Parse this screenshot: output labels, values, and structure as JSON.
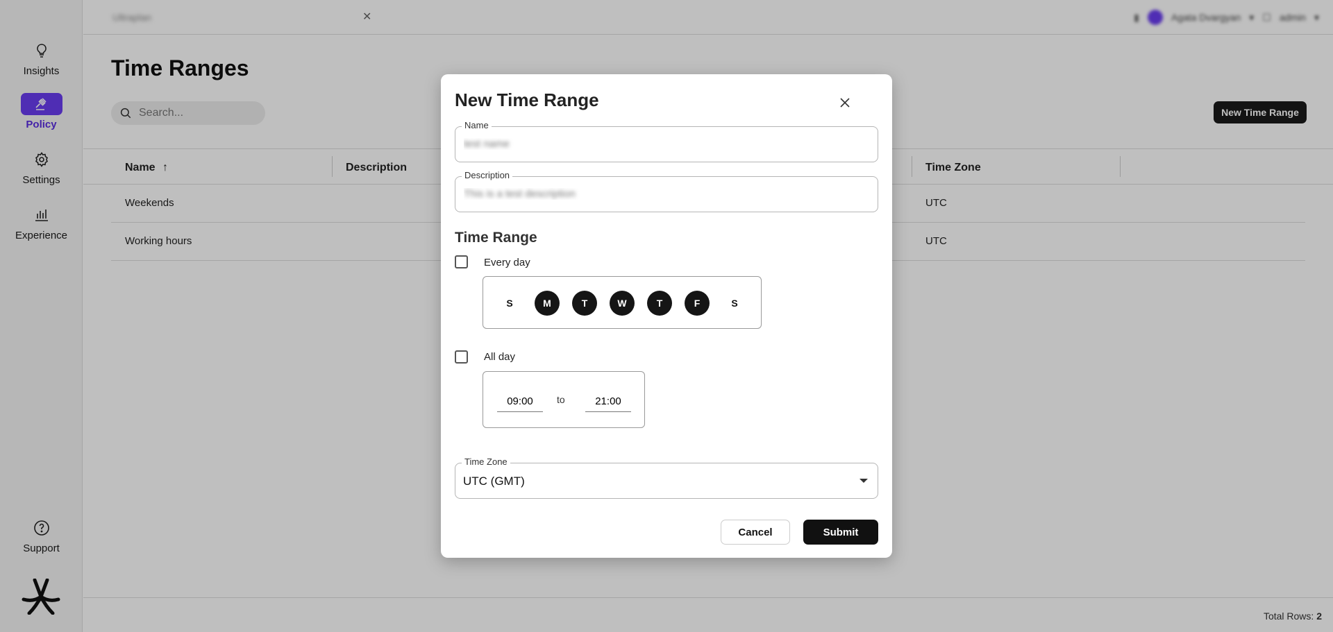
{
  "sidebar": {
    "items": [
      {
        "label": "Insights",
        "icon": "lightbulb-icon"
      },
      {
        "label": "Policy",
        "icon": "gavel-icon",
        "active": true
      },
      {
        "label": "Settings",
        "icon": "gear-icon"
      },
      {
        "label": "Experience",
        "icon": "bar-chart-icon"
      }
    ],
    "support": {
      "label": "Support",
      "icon": "help-circle-icon"
    }
  },
  "topbar": {
    "tenant": "Ultraplan",
    "user_name": "Agata Dvargyan",
    "account": "admin"
  },
  "page": {
    "title": "Time Ranges",
    "search_placeholder": "Search...",
    "new_button": "New Time Range"
  },
  "table": {
    "columns": [
      "Name",
      "Description",
      "Time Zone"
    ],
    "rows": [
      {
        "name": "Weekends",
        "description": "",
        "time_zone": "UTC"
      },
      {
        "name": "Working hours",
        "description": "",
        "time_zone": "UTC"
      }
    ]
  },
  "footer": {
    "total_label": "Total Rows:",
    "total_count": "2"
  },
  "modal": {
    "title": "New Time Range",
    "name_label": "Name",
    "name_placeholder": "test name",
    "description_label": "Description",
    "description_placeholder": "This is a test description",
    "section_title": "Time Range",
    "every_day_label": "Every day",
    "days": [
      {
        "letter": "S",
        "selected": false
      },
      {
        "letter": "M",
        "selected": true
      },
      {
        "letter": "T",
        "selected": true
      },
      {
        "letter": "W",
        "selected": true
      },
      {
        "letter": "T",
        "selected": true
      },
      {
        "letter": "F",
        "selected": true
      },
      {
        "letter": "S",
        "selected": false
      }
    ],
    "all_day_label": "All day",
    "time_start": "09:00",
    "time_to": "to",
    "time_end": "21:00",
    "time_zone_label": "Time Zone",
    "time_zone_value": "UTC (GMT)",
    "cancel_label": "Cancel",
    "submit_label": "Submit"
  },
  "colors": {
    "accent": "#6a3df0",
    "primary_button": "#111111"
  }
}
